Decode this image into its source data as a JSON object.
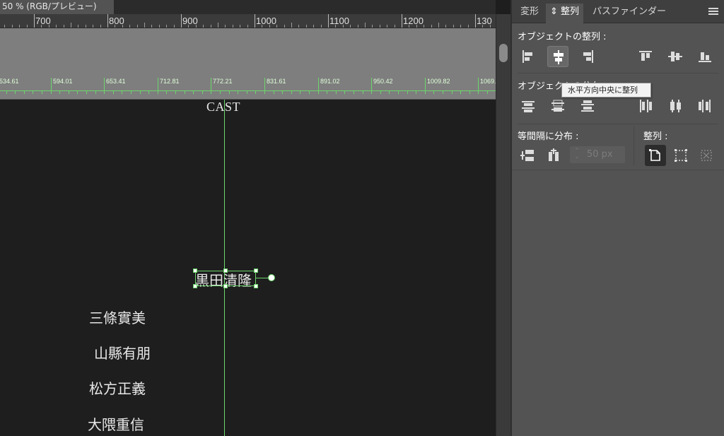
{
  "document": {
    "tab_title": "50 % (RGB/プレビュー)"
  },
  "ruler": {
    "labels": [
      "700",
      "800",
      "900",
      "1000",
      "1100",
      "1200",
      "130"
    ]
  },
  "guide_ruler": {
    "labels": [
      "534.61",
      "594.01",
      "653.41",
      "712.81",
      "772.21",
      "831.61",
      "891.02",
      "950.42",
      "1009.82",
      "1069."
    ],
    "color": "#6bd66b"
  },
  "canvas": {
    "heading": "CAST",
    "selected_text": "黒田清隆",
    "names": [
      "三條實美",
      "山縣有朋",
      "松方正義",
      "大隈重信"
    ]
  },
  "panel": {
    "tabs": [
      {
        "label": "変形",
        "active": false
      },
      {
        "label": "⇕ 整列",
        "active": true
      },
      {
        "label": "パスファインダー",
        "active": false
      }
    ],
    "align_objects_title": "オブジェクトの整列 :",
    "distribute_objects_title": "オブジェクトの分布 :",
    "distribute_spacing_title": "等間隔に分布 :",
    "align_to_title": "整列 :",
    "spacing_value": "50 px",
    "tooltip": "水平方向中央に整列"
  },
  "icons": {
    "align": [
      "align-left-icon",
      "align-horizontal-center-icon",
      "align-right-icon",
      "align-top-icon",
      "align-vertical-center-icon",
      "align-bottom-icon"
    ],
    "distribute": [
      "distribute-top-icon",
      "distribute-vertical-center-icon",
      "distribute-bottom-icon",
      "distribute-left-icon",
      "distribute-horizontal-center-icon",
      "distribute-right-icon"
    ],
    "spacing": [
      "vertical-distribute-space-icon",
      "horizontal-distribute-space-icon"
    ],
    "align_to": [
      "align-to-artboard-icon",
      "align-to-selection-icon",
      "align-to-key-object-icon"
    ]
  },
  "colors": {
    "guide": "#6bd66b",
    "panel_bg": "#535353",
    "canvas_bg": "#1e1e1e"
  }
}
